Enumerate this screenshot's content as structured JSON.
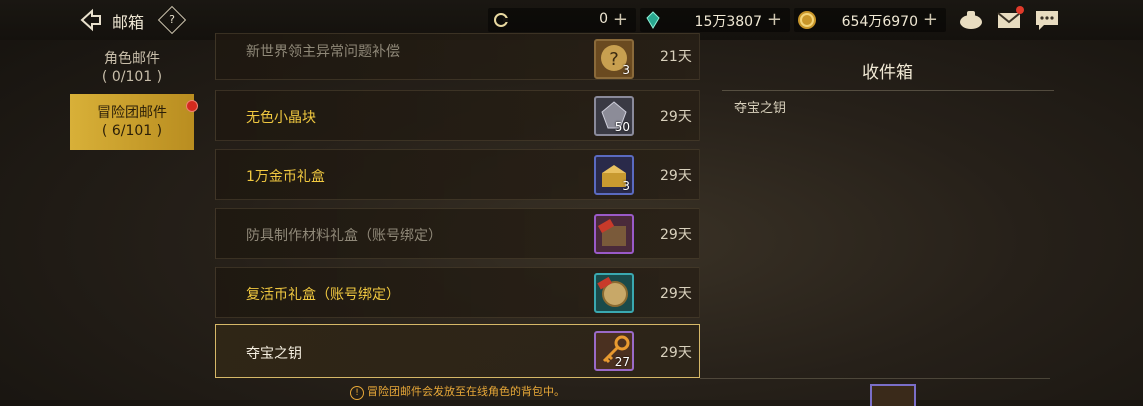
{
  "header": {
    "title": "邮箱",
    "help": "?",
    "currencies": [
      {
        "icon": "coin-c-icon",
        "value": "0",
        "plus": "+"
      },
      {
        "icon": "gem-icon",
        "value": "15万3807",
        "plus": "+"
      },
      {
        "icon": "gold-coin-icon",
        "value": "654万6970",
        "plus": "+"
      }
    ]
  },
  "tabs": [
    {
      "label": "角色邮件",
      "count": "( 0/101 )",
      "active": false
    },
    {
      "label": "冒险团邮件",
      "count": "( 6/101 )",
      "active": true
    }
  ],
  "mails": [
    {
      "name": "新世界领主异常问题补偿",
      "count": "3",
      "days": "21天",
      "icon": "question-mark-icon",
      "style": "muted"
    },
    {
      "name": "无色小晶块",
      "count": "50",
      "days": "29天",
      "icon": "crystal-icon",
      "style": "gold"
    },
    {
      "name": "1万金币礼盒",
      "count": "3",
      "days": "29天",
      "icon": "gold-chest-icon",
      "style": "gold"
    },
    {
      "name": "防具制作材料礼盒（账号绑定）",
      "count": "",
      "days": "29天",
      "icon": "armor-box-icon",
      "style": "muted"
    },
    {
      "name": "复活币礼盒（账号绑定）",
      "count": "",
      "days": "29天",
      "icon": "revive-coin-icon",
      "style": "gold"
    },
    {
      "name": "夺宝之钥",
      "count": "27",
      "days": "29天",
      "icon": "key-icon",
      "style": "white"
    }
  ],
  "inbox": {
    "title": "收件箱",
    "body": "夺宝之钥"
  },
  "notice": "冒险团邮件会发放至在线角色的背包中。",
  "notice_icon": "!"
}
